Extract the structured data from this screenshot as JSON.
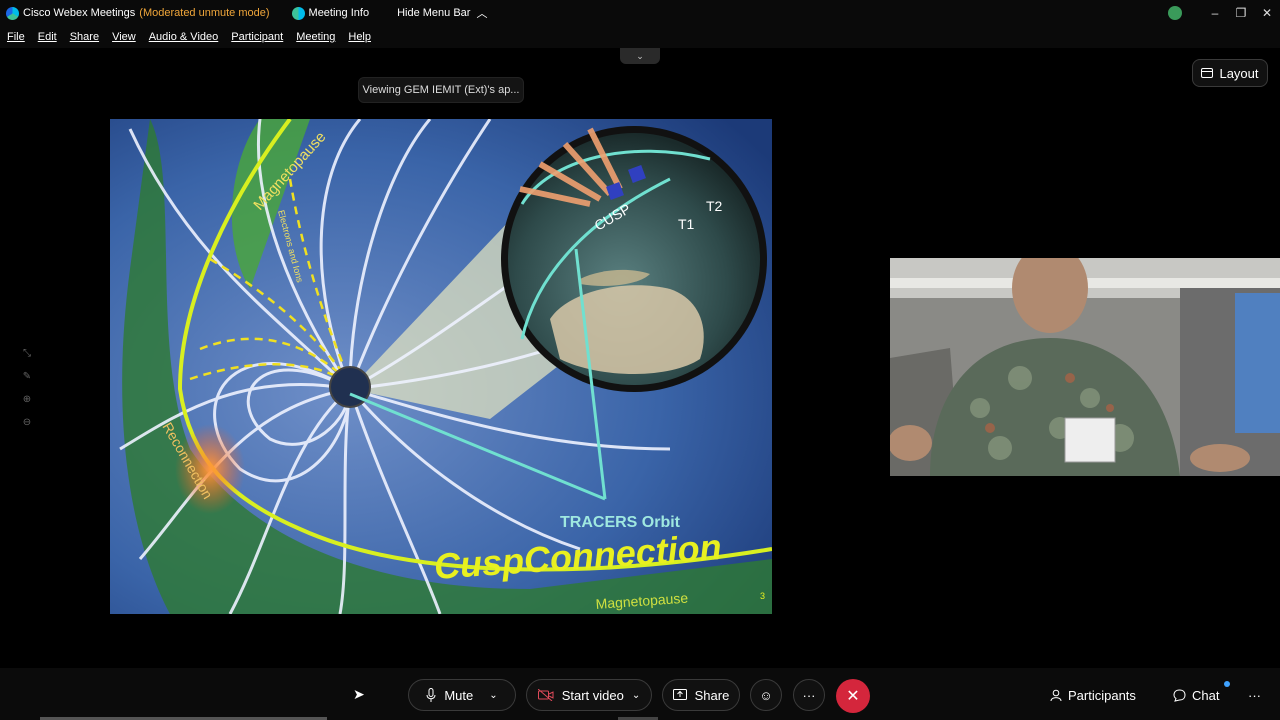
{
  "window": {
    "app_title": "Cisco Webex Meetings",
    "mode": "(Moderated unmute mode)",
    "meeting_info": "Meeting Info",
    "hide_menu_bar": "Hide Menu Bar",
    "controls": {
      "minimize": "–",
      "restore": "❐",
      "close": "✕"
    }
  },
  "menu": [
    "File",
    "Edit",
    "Share",
    "View",
    "Audio & Video",
    "Participant",
    "Meeting",
    "Help"
  ],
  "stage": {
    "collapse": "⌄",
    "layout_label": "Layout",
    "viewing_label": "Viewing GEM IEMIT (Ext)'s ap...",
    "side_tools": [
      "⤡",
      "✎",
      "⊕",
      "⊖"
    ]
  },
  "slide": {
    "labels": {
      "magnetopause_top": "Magnetopause",
      "electrons": "Electrons and Ions",
      "reconnection": "Reconnection",
      "cusp": "CUSP",
      "t1": "T1",
      "t2": "T2",
      "tracers": "TRACERS Orbit",
      "title": "CuspConnection",
      "magnetopause_bottom": "Magnetopause",
      "page": "3"
    }
  },
  "toolbar": {
    "mute": "Mute",
    "start_video": "Start video",
    "share": "Share",
    "reactions_icon": "☺",
    "more": "···",
    "end": "✕",
    "participants": "Participants",
    "chat": "Chat",
    "overflow": "···"
  },
  "colors": {
    "end_button": "#d4263c",
    "mode_text": "#f0a63a",
    "title_yellow": "#e8f020"
  }
}
